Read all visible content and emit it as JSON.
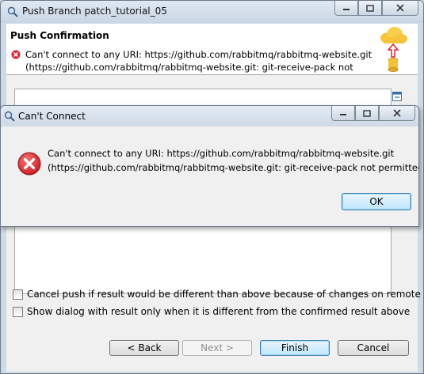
{
  "window": {
    "title": "Push Branch patch_tutorial_05"
  },
  "header": {
    "title": "Push Confirmation",
    "message_line1": "Can't connect to any URI: https://github.com/rabbitmq/rabbitmq-website.git",
    "message_line2": "(https://github.com/rabbitmq/rabbitmq-website.git: git-receive-pack not"
  },
  "options": {
    "cancel_push_label": "Cancel push if result would be different than above because of changes on remote",
    "cancel_push_checked": false,
    "show_dialog_label": "Show dialog with result only when it is different from the confirmed result above",
    "show_dialog_checked": false
  },
  "buttons": {
    "back": "< Back",
    "next": "Next >",
    "finish": "Finish",
    "cancel": "Cancel"
  },
  "dialog": {
    "title": "Can't Connect",
    "message_line1": "Can't connect to any URI: https://github.com/rabbitmq/rabbitmq-website.git",
    "message_line2": "(https://github.com/rabbitmq/rabbitmq-website.git: git-receive-pack not permitted)",
    "ok": "OK"
  },
  "colors": {
    "error_red": "#d9232e",
    "accent_blue": "#3c7fb1"
  }
}
